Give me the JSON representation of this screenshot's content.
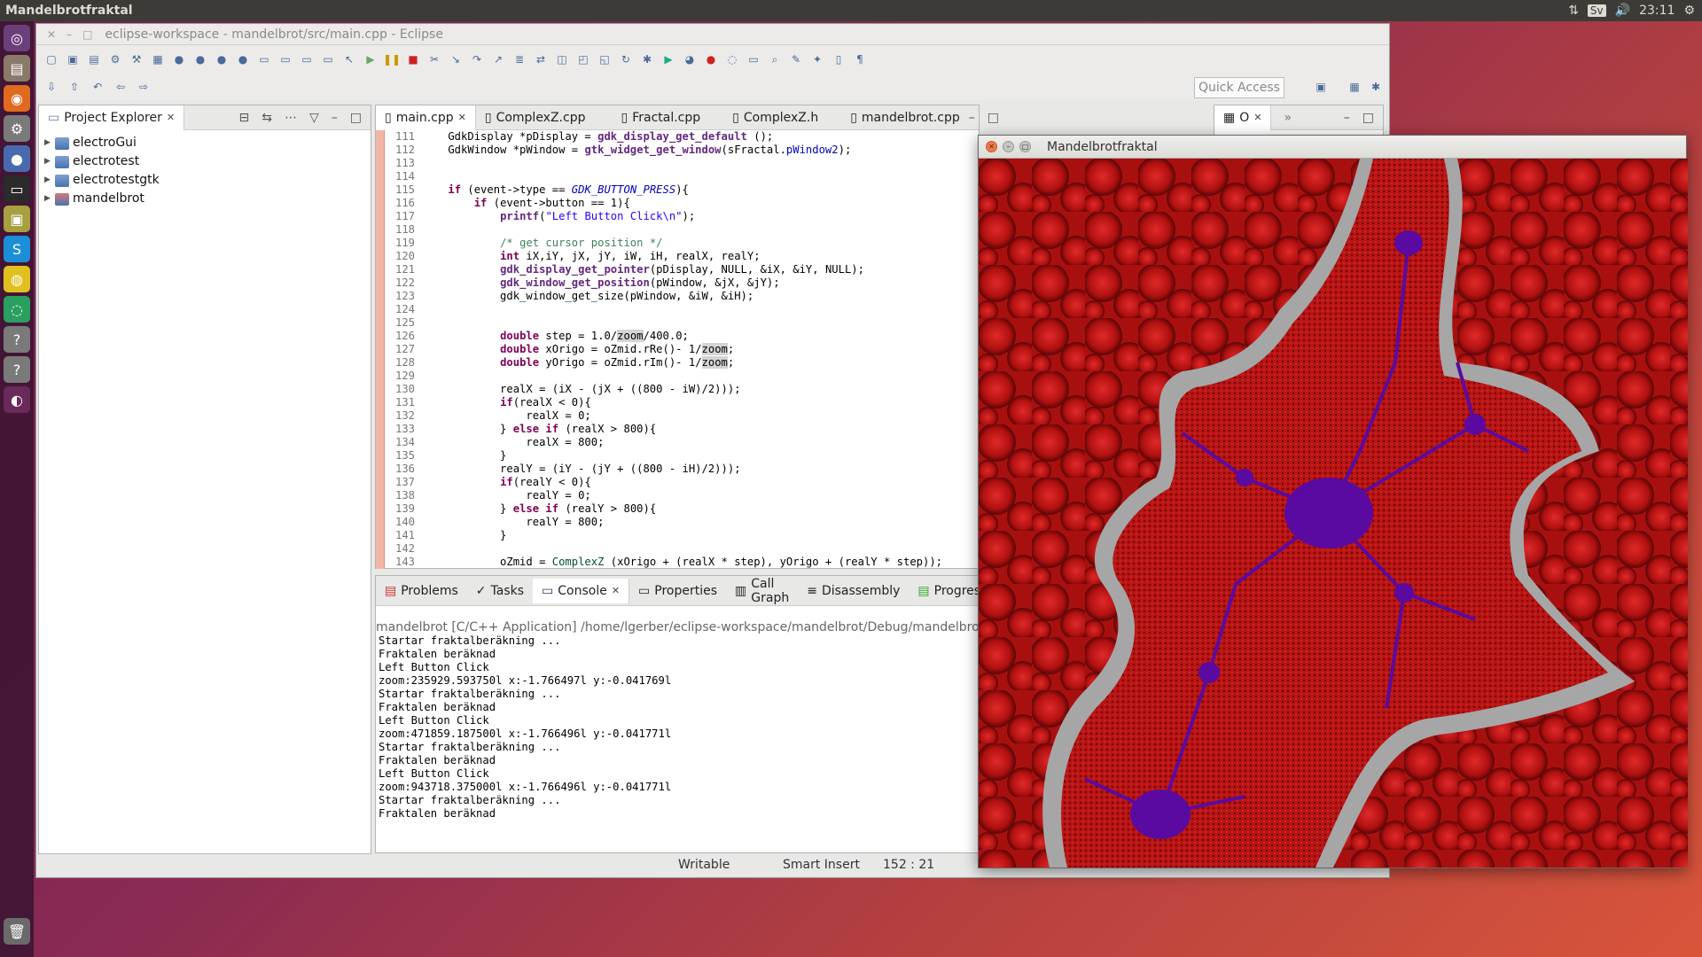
{
  "topbar": {
    "app": "Mandelbrotfraktal",
    "kb": "Sv",
    "clock": "23:11"
  },
  "eclipse": {
    "title": "eclipse-workspace - mandelbrot/src/main.cpp - Eclipse",
    "quick_access": "Quick Access"
  },
  "explorer": {
    "title": "Project Explorer",
    "items": [
      "electroGui",
      "electrotest",
      "electrotestgtk",
      "mandelbrot"
    ]
  },
  "editor": {
    "tabs": [
      "main.cpp",
      "ComplexZ.cpp",
      "Fractal.cpp",
      "ComplexZ.h",
      "mandelbrot.cpp"
    ],
    "line_numbers": "111\n112\n113\n114\n115\n116\n117\n118\n119\n120\n121\n122\n123\n124\n125\n126\n127\n128\n129\n130\n131\n132\n133\n134\n135\n136\n137\n138\n139\n140\n141\n142\n143"
  },
  "bottom": {
    "tabs": [
      "Problems",
      "Tasks",
      "Console",
      "Properties",
      "Call Graph",
      "Disassembly",
      "Progress"
    ],
    "path": "mandelbrot [C/C++ Application] /home/lgerber/eclipse-workspace/mandelbrot/Debug/mandelbrot",
    "output": "Startar fraktalberäkning ...\nFraktalen beräknad\nLeft Button Click\nzoom:235929.593750l x:-1.766497l y:-0.041769l\nStartar fraktalberäkning ...\nFraktalen beräknad\nLeft Button Click\nzoom:471859.187500l x:-1.766496l y:-0.041771l\nStartar fraktalberäkning ...\nFraktalen beräknad\nLeft Button Click\nzoom:943718.375000l x:-1.766496l y:-0.041771l\nStartar fraktalberäkning ...\nFraktalen beräknad"
  },
  "status": {
    "writable": "Writable",
    "insert": "Smart Insert",
    "position": "152 : 21"
  },
  "outline": {
    "label": "O"
  },
  "fractal": {
    "title": "Mandelbrotfraktal"
  },
  "colors": {
    "fractal_red": "#c01616",
    "fractal_gray": "#a9a9a9",
    "fractal_purple": "#5a0aa0",
    "gutter": "#f1b6a3"
  }
}
